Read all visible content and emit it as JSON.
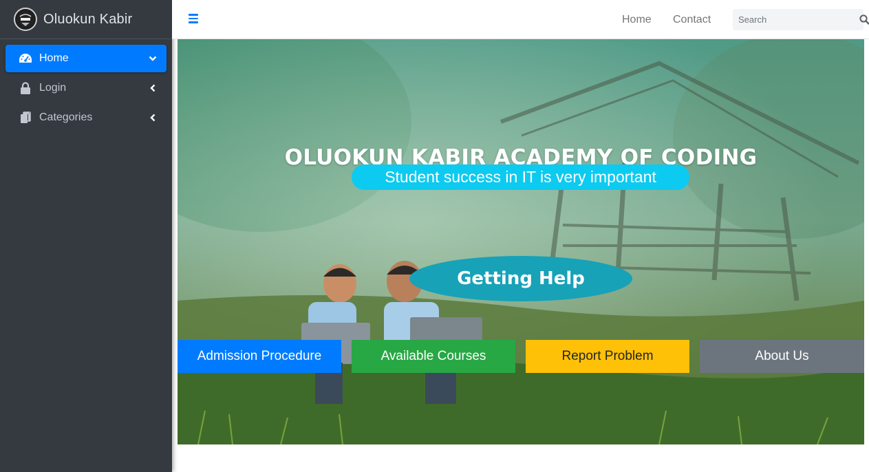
{
  "brand": {
    "name": "Oluokun Kabir",
    "logo_icon": "academy-logo-icon"
  },
  "sidebar": {
    "items": [
      {
        "label": "Home",
        "icon": "dashboard-gauge-icon",
        "caret": "chevron-down-icon",
        "active": true
      },
      {
        "label": "Login",
        "icon": "lock-icon",
        "caret": "chevron-left-icon",
        "active": false
      },
      {
        "label": "Categories",
        "icon": "copy-icon",
        "caret": "chevron-left-icon",
        "active": false
      }
    ]
  },
  "topbar": {
    "menu_icon": "hamburger-menu-icon",
    "links": [
      "Home",
      "Contact"
    ],
    "search": {
      "placeholder": "Search",
      "value": "",
      "icon": "search-icon"
    }
  },
  "hero": {
    "title": "OLUOKUN KABIR ACADEMY OF CODING",
    "tagline": "Student success in IT is very important",
    "help_button": "Getting Help",
    "buttons": [
      "Admission Procedure",
      "Available Courses",
      "Report Problem",
      "About Us"
    ]
  },
  "colors": {
    "sidebar_bg": "#343a40",
    "primary": "#007bff",
    "success": "#28a745",
    "warning": "#ffc107",
    "secondary": "#6c757d",
    "info": "#17a2b8",
    "cyan": "#0dcaf0"
  }
}
